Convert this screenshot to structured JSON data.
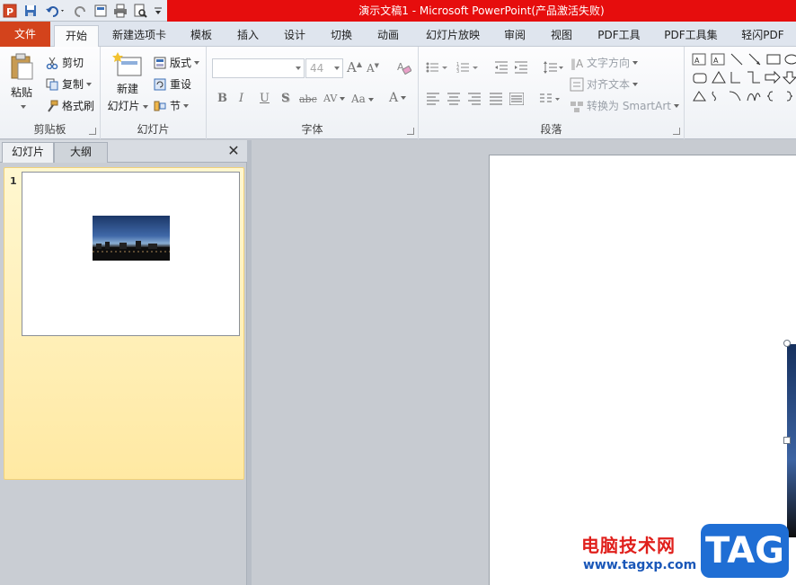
{
  "window": {
    "title": "演示文稿1 - Microsoft PowerPoint(产品激活失败)"
  },
  "ribbon_tabs": [
    {
      "label": "文件"
    },
    {
      "label": "开始"
    },
    {
      "label": "新建选项卡"
    },
    {
      "label": "模板"
    },
    {
      "label": "插入"
    },
    {
      "label": "设计"
    },
    {
      "label": "切换"
    },
    {
      "label": "动画"
    },
    {
      "label": "幻灯片放映"
    },
    {
      "label": "审阅"
    },
    {
      "label": "视图"
    },
    {
      "label": "PDF工具"
    },
    {
      "label": "PDF工具集"
    },
    {
      "label": "轻闪PDF"
    }
  ],
  "clipboard": {
    "paste": "粘贴",
    "cut": "剪切",
    "copy": "复制",
    "format_painter": "格式刷",
    "label": "剪贴板"
  },
  "slides_group": {
    "new_slide_line1": "新建",
    "new_slide_line2": "幻灯片",
    "layout": "版式",
    "reset": "重设",
    "section": "节",
    "label": "幻灯片"
  },
  "font_group": {
    "font_size": "44",
    "bold": "B",
    "italic": "I",
    "underline": "U",
    "shadow": "S",
    "strikethrough": "abc",
    "spacing": "AV",
    "case": "Aa",
    "color": "A",
    "label": "字体"
  },
  "paragraph_group": {
    "text_direction": "文字方向",
    "align_text": "对齐文本",
    "convert_smartart": "转换为 SmartArt",
    "label": "段落"
  },
  "left_pane": {
    "tab_slides": "幻灯片",
    "tab_outline": "大纲",
    "close": "✕",
    "slide_number": "1"
  },
  "watermark": {
    "text": "电脑技术网",
    "url": "www.tagxp.com",
    "tag": "TAG"
  },
  "colors": {
    "title_bar": "#e60d0d",
    "file_tab": "#d3431c",
    "thumb_highlight": "#ffe9a3"
  }
}
